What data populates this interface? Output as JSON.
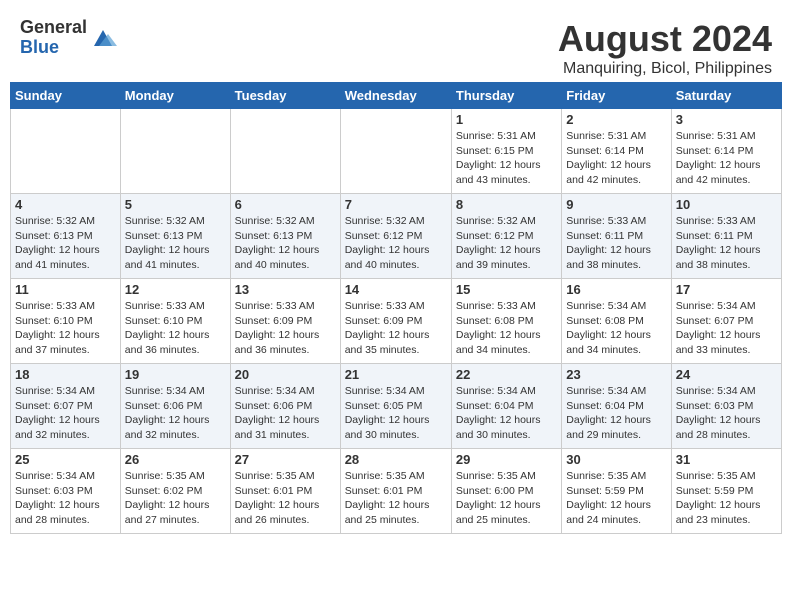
{
  "header": {
    "logo_general": "General",
    "logo_blue": "Blue",
    "month_year": "August 2024",
    "location": "Manquiring, Bicol, Philippines"
  },
  "days_of_week": [
    "Sunday",
    "Monday",
    "Tuesday",
    "Wednesday",
    "Thursday",
    "Friday",
    "Saturday"
  ],
  "weeks": [
    [
      {
        "day": "",
        "info": ""
      },
      {
        "day": "",
        "info": ""
      },
      {
        "day": "",
        "info": ""
      },
      {
        "day": "",
        "info": ""
      },
      {
        "day": "1",
        "info": "Sunrise: 5:31 AM\nSunset: 6:15 PM\nDaylight: 12 hours and 43 minutes."
      },
      {
        "day": "2",
        "info": "Sunrise: 5:31 AM\nSunset: 6:14 PM\nDaylight: 12 hours and 42 minutes."
      },
      {
        "day": "3",
        "info": "Sunrise: 5:31 AM\nSunset: 6:14 PM\nDaylight: 12 hours and 42 minutes."
      }
    ],
    [
      {
        "day": "4",
        "info": "Sunrise: 5:32 AM\nSunset: 6:13 PM\nDaylight: 12 hours and 41 minutes."
      },
      {
        "day": "5",
        "info": "Sunrise: 5:32 AM\nSunset: 6:13 PM\nDaylight: 12 hours and 41 minutes."
      },
      {
        "day": "6",
        "info": "Sunrise: 5:32 AM\nSunset: 6:13 PM\nDaylight: 12 hours and 40 minutes."
      },
      {
        "day": "7",
        "info": "Sunrise: 5:32 AM\nSunset: 6:12 PM\nDaylight: 12 hours and 40 minutes."
      },
      {
        "day": "8",
        "info": "Sunrise: 5:32 AM\nSunset: 6:12 PM\nDaylight: 12 hours and 39 minutes."
      },
      {
        "day": "9",
        "info": "Sunrise: 5:33 AM\nSunset: 6:11 PM\nDaylight: 12 hours and 38 minutes."
      },
      {
        "day": "10",
        "info": "Sunrise: 5:33 AM\nSunset: 6:11 PM\nDaylight: 12 hours and 38 minutes."
      }
    ],
    [
      {
        "day": "11",
        "info": "Sunrise: 5:33 AM\nSunset: 6:10 PM\nDaylight: 12 hours and 37 minutes."
      },
      {
        "day": "12",
        "info": "Sunrise: 5:33 AM\nSunset: 6:10 PM\nDaylight: 12 hours and 36 minutes."
      },
      {
        "day": "13",
        "info": "Sunrise: 5:33 AM\nSunset: 6:09 PM\nDaylight: 12 hours and 36 minutes."
      },
      {
        "day": "14",
        "info": "Sunrise: 5:33 AM\nSunset: 6:09 PM\nDaylight: 12 hours and 35 minutes."
      },
      {
        "day": "15",
        "info": "Sunrise: 5:33 AM\nSunset: 6:08 PM\nDaylight: 12 hours and 34 minutes."
      },
      {
        "day": "16",
        "info": "Sunrise: 5:34 AM\nSunset: 6:08 PM\nDaylight: 12 hours and 34 minutes."
      },
      {
        "day": "17",
        "info": "Sunrise: 5:34 AM\nSunset: 6:07 PM\nDaylight: 12 hours and 33 minutes."
      }
    ],
    [
      {
        "day": "18",
        "info": "Sunrise: 5:34 AM\nSunset: 6:07 PM\nDaylight: 12 hours and 32 minutes."
      },
      {
        "day": "19",
        "info": "Sunrise: 5:34 AM\nSunset: 6:06 PM\nDaylight: 12 hours and 32 minutes."
      },
      {
        "day": "20",
        "info": "Sunrise: 5:34 AM\nSunset: 6:06 PM\nDaylight: 12 hours and 31 minutes."
      },
      {
        "day": "21",
        "info": "Sunrise: 5:34 AM\nSunset: 6:05 PM\nDaylight: 12 hours and 30 minutes."
      },
      {
        "day": "22",
        "info": "Sunrise: 5:34 AM\nSunset: 6:04 PM\nDaylight: 12 hours and 30 minutes."
      },
      {
        "day": "23",
        "info": "Sunrise: 5:34 AM\nSunset: 6:04 PM\nDaylight: 12 hours and 29 minutes."
      },
      {
        "day": "24",
        "info": "Sunrise: 5:34 AM\nSunset: 6:03 PM\nDaylight: 12 hours and 28 minutes."
      }
    ],
    [
      {
        "day": "25",
        "info": "Sunrise: 5:34 AM\nSunset: 6:03 PM\nDaylight: 12 hours and 28 minutes."
      },
      {
        "day": "26",
        "info": "Sunrise: 5:35 AM\nSunset: 6:02 PM\nDaylight: 12 hours and 27 minutes."
      },
      {
        "day": "27",
        "info": "Sunrise: 5:35 AM\nSunset: 6:01 PM\nDaylight: 12 hours and 26 minutes."
      },
      {
        "day": "28",
        "info": "Sunrise: 5:35 AM\nSunset: 6:01 PM\nDaylight: 12 hours and 25 minutes."
      },
      {
        "day": "29",
        "info": "Sunrise: 5:35 AM\nSunset: 6:00 PM\nDaylight: 12 hours and 25 minutes."
      },
      {
        "day": "30",
        "info": "Sunrise: 5:35 AM\nSunset: 5:59 PM\nDaylight: 12 hours and 24 minutes."
      },
      {
        "day": "31",
        "info": "Sunrise: 5:35 AM\nSunset: 5:59 PM\nDaylight: 12 hours and 23 minutes."
      }
    ]
  ]
}
